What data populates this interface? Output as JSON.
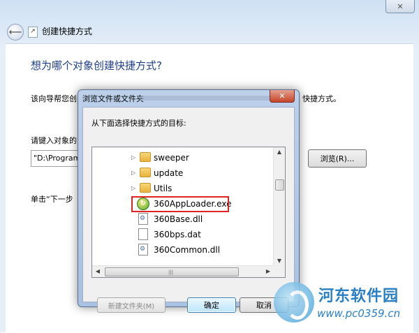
{
  "wizard": {
    "close_label": "✕",
    "back_icon": "back-arrow-icon",
    "title": "创建快捷方式",
    "heading": "想为哪个对象创建快捷方式?",
    "description_start": "该向导帮您创",
    "description_end": "快捷方式。",
    "prompt": "请键入对象的",
    "path_value": "\"D:\\Program",
    "browse_label": "浏览(R)...",
    "hint": "单击“下一步"
  },
  "dialog": {
    "title": "浏览文件或文件夹",
    "close_label": "✕",
    "prompt": "从下面选择快捷方式的目标:",
    "items": [
      {
        "label": "sweeper",
        "type": "folder"
      },
      {
        "label": "update",
        "type": "folder"
      },
      {
        "label": "Utils",
        "type": "folder"
      },
      {
        "label": "360AppLoader.exe",
        "type": "exe",
        "highlighted": true
      },
      {
        "label": "360Base.dll",
        "type": "dll"
      },
      {
        "label": "360bps.dat",
        "type": "file"
      },
      {
        "label": "360Common.dll",
        "type": "dll"
      }
    ],
    "new_folder_label": "新建文件夹(M)",
    "ok_label": "确定",
    "cancel_label": "取消"
  },
  "watermark": {
    "name": "河东软件园",
    "url": "www.pc0359.cn"
  },
  "colors": {
    "heading": "#1e3f8a",
    "highlight_border": "#e02424",
    "watermark": "#2a7fc4"
  }
}
